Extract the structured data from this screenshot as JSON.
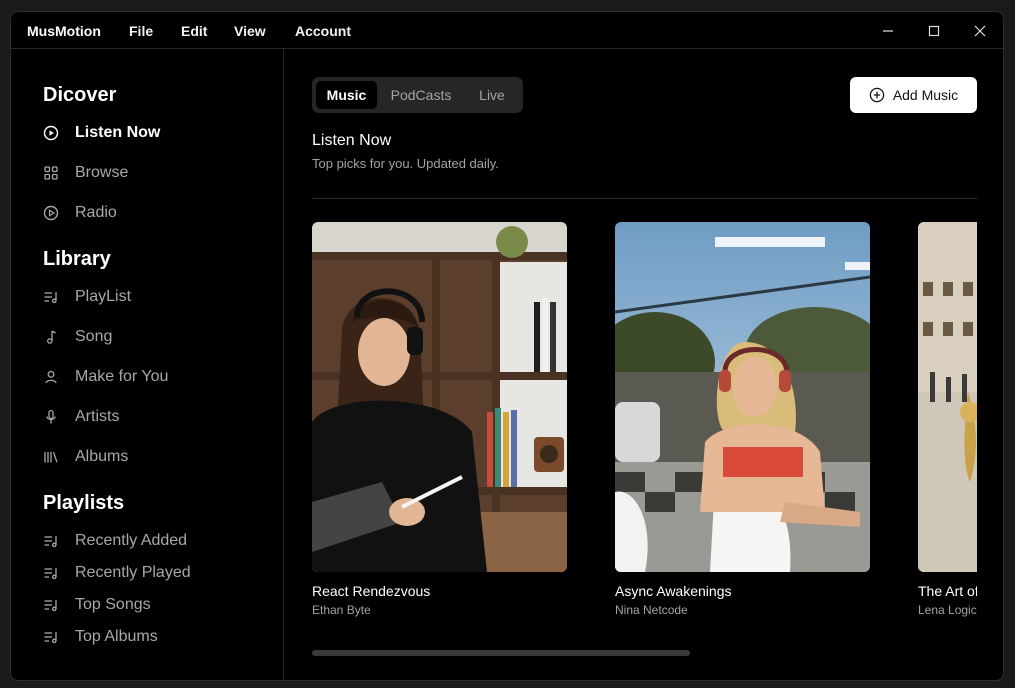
{
  "app": {
    "name": "MusMotion",
    "menu": [
      "File",
      "Edit",
      "View",
      "Account"
    ]
  },
  "sidebar": {
    "sections": [
      {
        "title": "Dicover",
        "items": [
          {
            "label": "Listen Now",
            "icon": "play-circle-icon",
            "active": true
          },
          {
            "label": "Browse",
            "icon": "grid-icon"
          },
          {
            "label": "Radio",
            "icon": "radio-icon"
          }
        ]
      },
      {
        "title": "Library",
        "items": [
          {
            "label": "PlayList",
            "icon": "playlist-icon"
          },
          {
            "label": "Song",
            "icon": "music-note-icon"
          },
          {
            "label": "Make for You",
            "icon": "user-icon"
          },
          {
            "label": "Artists",
            "icon": "microphone-icon"
          },
          {
            "label": "Albums",
            "icon": "library-icon"
          }
        ]
      },
      {
        "title": "Playlists",
        "items": [
          {
            "label": "Recently Added",
            "icon": "playlist-icon"
          },
          {
            "label": "Recently Played",
            "icon": "playlist-icon"
          },
          {
            "label": "Top Songs",
            "icon": "playlist-icon"
          },
          {
            "label": "Top Albums",
            "icon": "playlist-icon"
          }
        ]
      }
    ]
  },
  "main": {
    "tabs": [
      {
        "label": "Music",
        "active": true
      },
      {
        "label": "PodCasts"
      },
      {
        "label": "Live"
      }
    ],
    "add_button": "Add Music",
    "heading": "Listen Now",
    "subheading": "Top picks for you. Updated daily.",
    "cards": [
      {
        "title": "React Rendezvous",
        "artist": "Ethan Byte"
      },
      {
        "title": "Async Awakenings",
        "artist": "Nina Netcode"
      },
      {
        "title": "The Art of Reusability",
        "artist": "Lena Logic"
      }
    ]
  },
  "colors": {
    "background": "#000000",
    "border": "#262626",
    "text_muted": "#a3a3a3",
    "accent": "#ffffff"
  }
}
